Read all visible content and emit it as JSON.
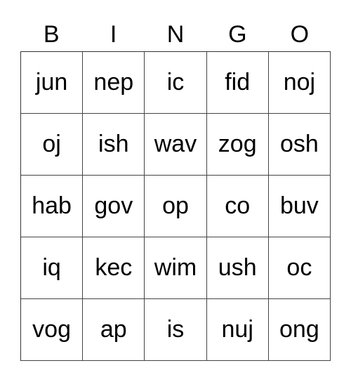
{
  "header": [
    "B",
    "I",
    "N",
    "G",
    "O"
  ],
  "rows": [
    [
      "jun",
      "nep",
      "ic",
      "fid",
      "noj"
    ],
    [
      "oj",
      "ish",
      "wav",
      "zog",
      "osh"
    ],
    [
      "hab",
      "gov",
      "op",
      "co",
      "buv"
    ],
    [
      "iq",
      "kec",
      "wim",
      "ush",
      "oc"
    ],
    [
      "vog",
      "ap",
      "is",
      "nuj",
      "ong"
    ]
  ]
}
